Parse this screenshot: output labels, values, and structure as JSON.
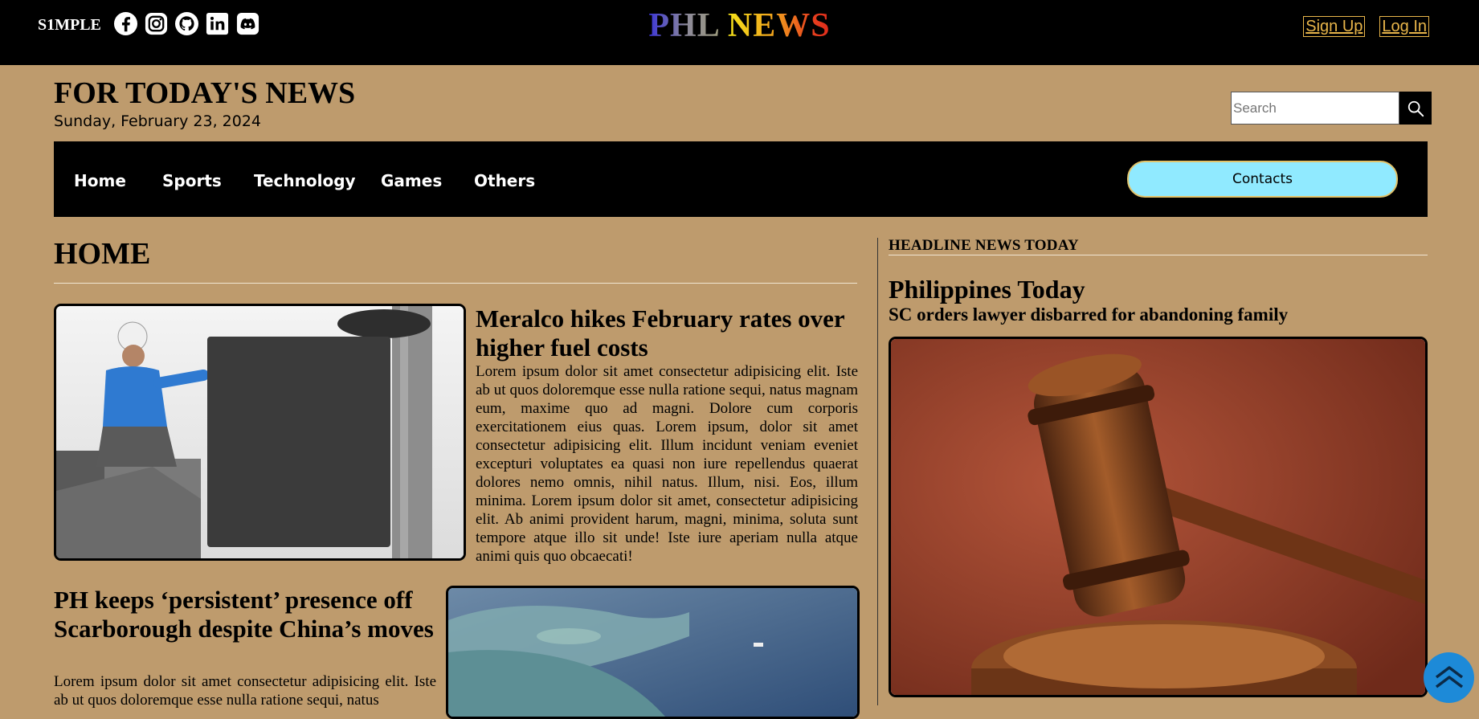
{
  "topbar": {
    "brand": "S1MPLE",
    "socials": [
      {
        "icon": "facebook-icon"
      },
      {
        "icon": "instagram-icon"
      },
      {
        "icon": "github-icon"
      },
      {
        "icon": "linkedin-icon"
      },
      {
        "icon": "discord-icon"
      }
    ],
    "logo_part1": "PHL",
    "logo_part2": "NEWS",
    "signup": "Sign Up",
    "login": "Log In"
  },
  "header": {
    "title": "FOR TODAY'S NEWS",
    "date": "Sunday, February 23, 2024",
    "search_placeholder": "Search"
  },
  "nav": {
    "items": [
      "Home",
      "Sports",
      "Technology",
      "Games",
      "Others"
    ],
    "contacts": "Contacts"
  },
  "main": {
    "section_title": "HOME",
    "articles": [
      {
        "title": "Meralco hikes February rates over higher fuel costs",
        "body": "Lorem ipsum dolor sit amet consectetur adipisicing elit. Iste ab ut quos doloremque esse nulla ratione sequi, natus magnam eum, maxime quo ad magni. Dolore cum corporis exercitationem eius quas. Lorem ipsum, dolor sit amet consectetur adipisicing elit. Illum incidunt veniam eveniet excepturi voluptates ea quasi non iure repellendus quaerat dolores nemo omnis, nihil natus. Illum, nisi. Eos, illum minima. Lorem ipsum dolor sit amet, consectetur adipisicing elit. Ab animi provident harum, magni, minima, soluta sunt tempore atque illo sit unde! Iste iure aperiam nulla atque animi quis quo obcaecati!"
      },
      {
        "title": "PH keeps ‘persistent’ presence off Scarborough despite China’s moves",
        "body": "Lorem ipsum dolor sit amet consectetur adipisicing elit. Iste ab ut quos doloremque esse nulla ratione sequi, natus"
      }
    ]
  },
  "sidebar": {
    "label": "HEADLINE NEWS TODAY",
    "subtitle": "Philippines Today",
    "headline": "SC orders lawyer disbarred for abandoning family"
  },
  "colors": {
    "page_bg": "#be9b6d",
    "accent_gold": "#e8b54a",
    "contacts_bg": "#90eaff",
    "fab": "#1d8ad8"
  }
}
